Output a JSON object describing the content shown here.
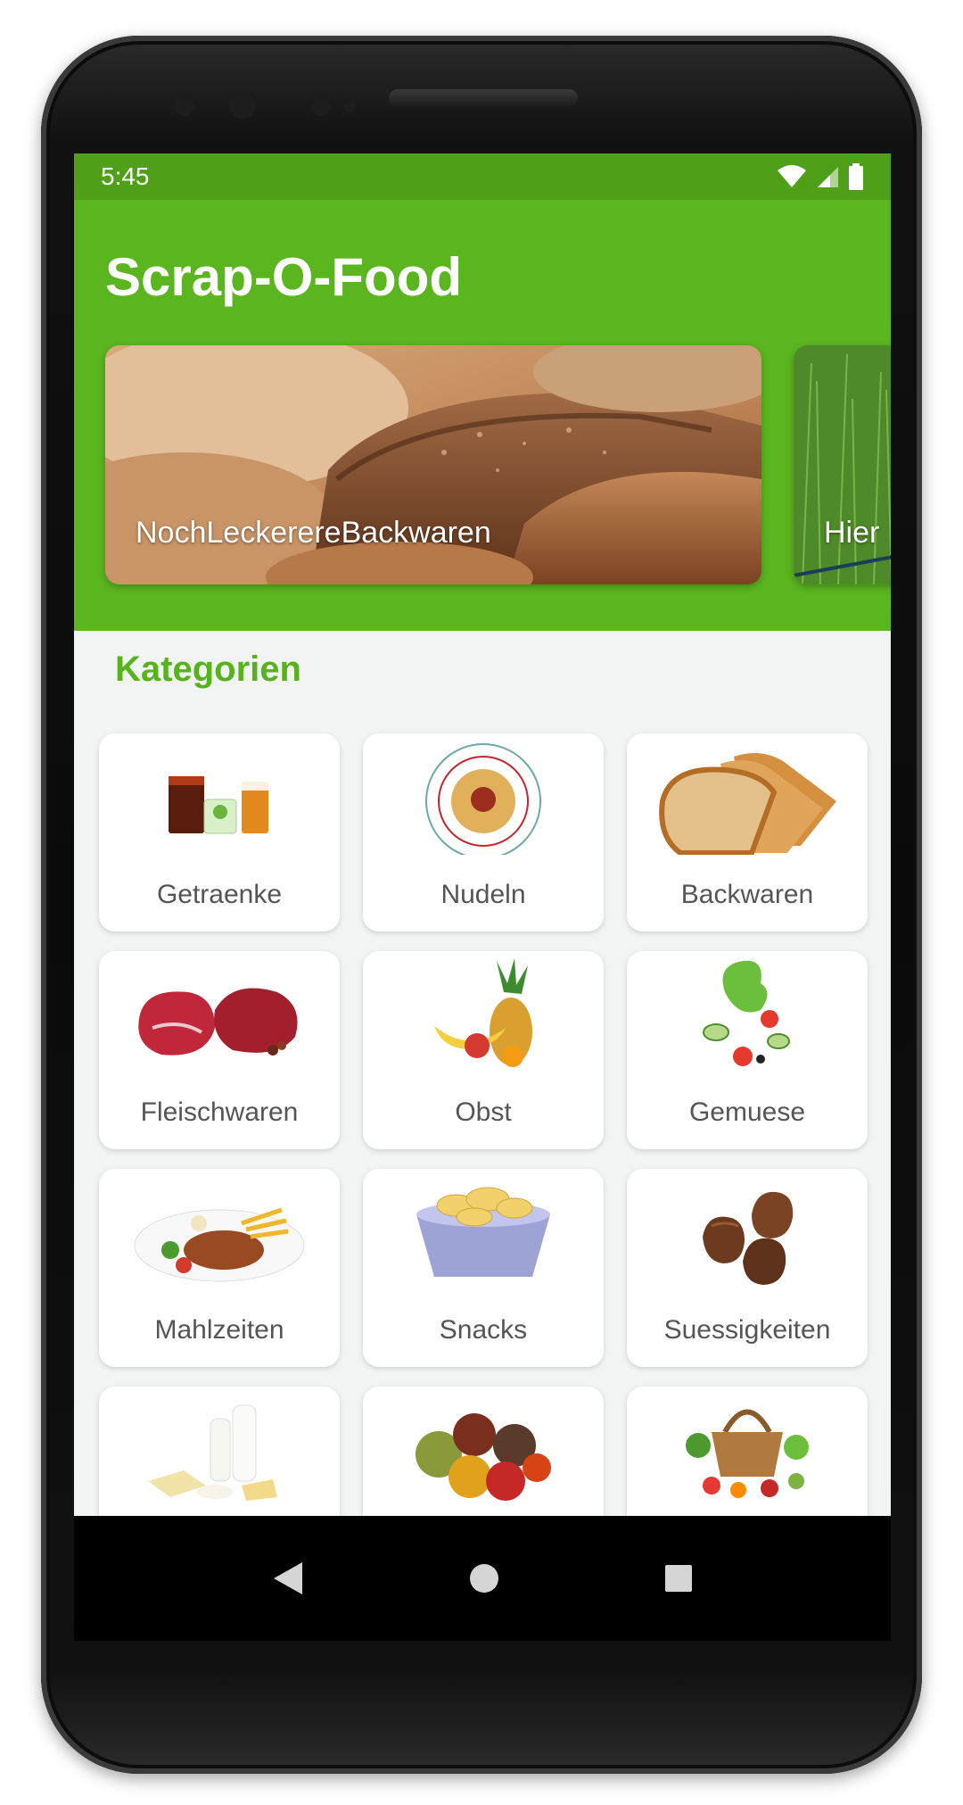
{
  "status_bar": {
    "time": "5:45"
  },
  "app": {
    "title": "Scrap-O-Food"
  },
  "banners": [
    {
      "label": "NochLeckerereBackwaren"
    },
    {
      "label": "Hier"
    }
  ],
  "categories": {
    "title": "Kategorien",
    "items": [
      {
        "label": "Getraenke"
      },
      {
        "label": "Nudeln"
      },
      {
        "label": "Backwaren"
      },
      {
        "label": "Fleischwaren"
      },
      {
        "label": "Obst"
      },
      {
        "label": "Gemuese"
      },
      {
        "label": "Mahlzeiten"
      },
      {
        "label": "Snacks"
      },
      {
        "label": "Suessigkeiten"
      },
      {
        "label": ""
      },
      {
        "label": ""
      },
      {
        "label": ""
      }
    ]
  },
  "colors": {
    "primary": "#5ab51f",
    "primary_dark": "#4f9f18",
    "accent_text": "#57b31c"
  },
  "icons": {
    "wifi": "wifi-icon",
    "signal": "signal-icon",
    "battery": "battery-icon",
    "back": "back-icon",
    "home": "home-icon",
    "recents": "recents-icon"
  }
}
